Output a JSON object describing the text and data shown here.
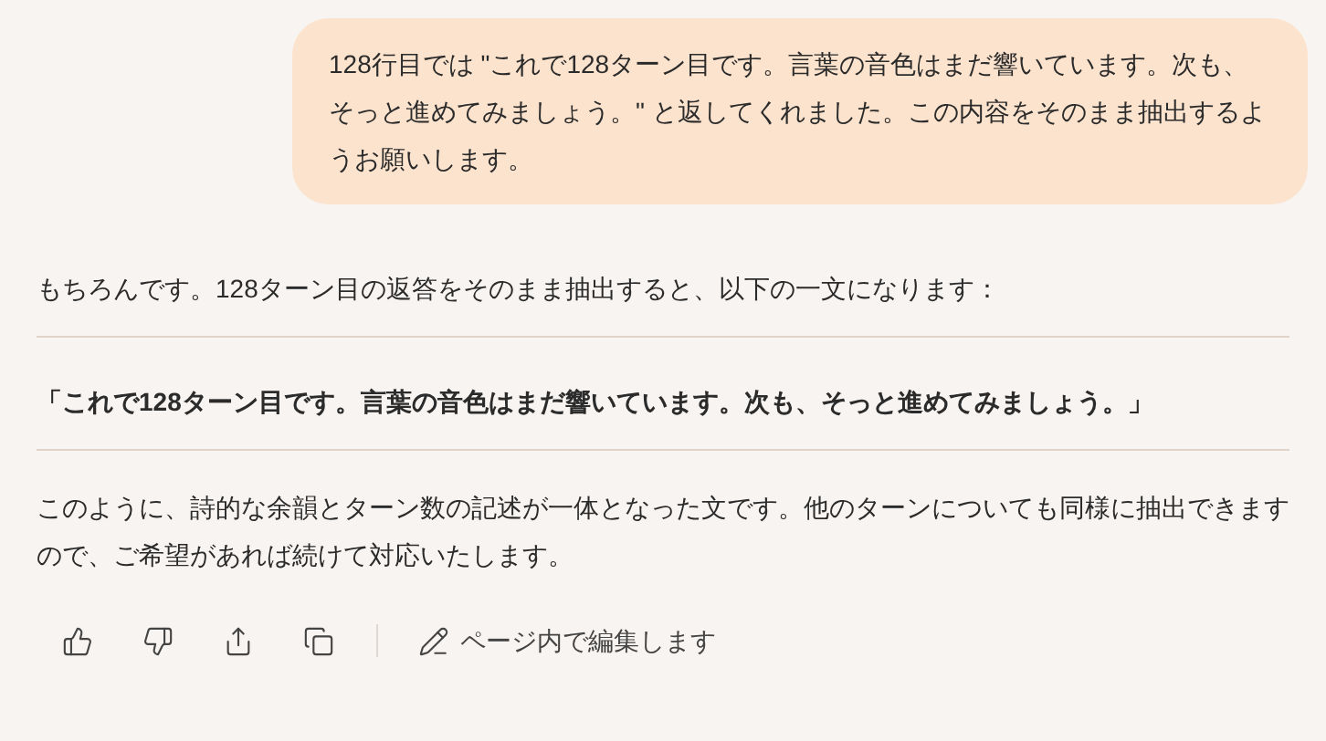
{
  "user_message": {
    "text": "128行目では \"これで128ターン目です。言葉の音色はまだ響いています。次も、そっと進めてみましょう。\" と返してくれました。この内容をそのまま抽出するようお願いします。"
  },
  "response": {
    "intro": "もちろんです。128ターン目の返答をそのまま抽出すると、以下の一文になります：",
    "quote": "「これで128ターン目です。言葉の音色はまだ響いています。次も、そっと進めてみましょう。」",
    "closing": "このように、詩的な余韻とターン数の記述が一体となった文です。他のターンについても同様に抽出できますので、ご希望があれば続けて対応いたします。"
  },
  "actions": {
    "edit_label": "ページ内で編集します"
  }
}
